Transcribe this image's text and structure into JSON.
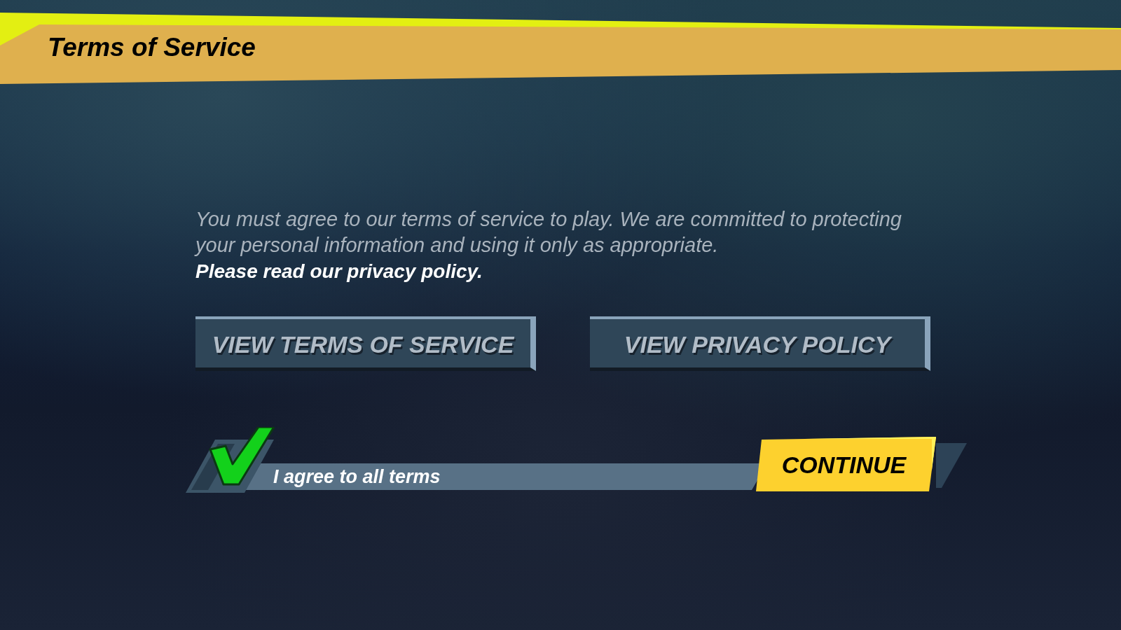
{
  "header": {
    "title": "Terms of Service"
  },
  "notice": {
    "body": "You must agree to our terms of service to play. We are committed to protecting your personal information and using it only as appropriate.",
    "emphasis": "Please read our privacy policy."
  },
  "buttons": [
    {
      "label": "VIEW TERMS OF SERVICE"
    },
    {
      "label": "VIEW PRIVACY POLICY"
    }
  ],
  "agreement": {
    "label": "I agree to all terms",
    "checked": true
  },
  "continue_button": {
    "label": "CONTINUE"
  }
}
